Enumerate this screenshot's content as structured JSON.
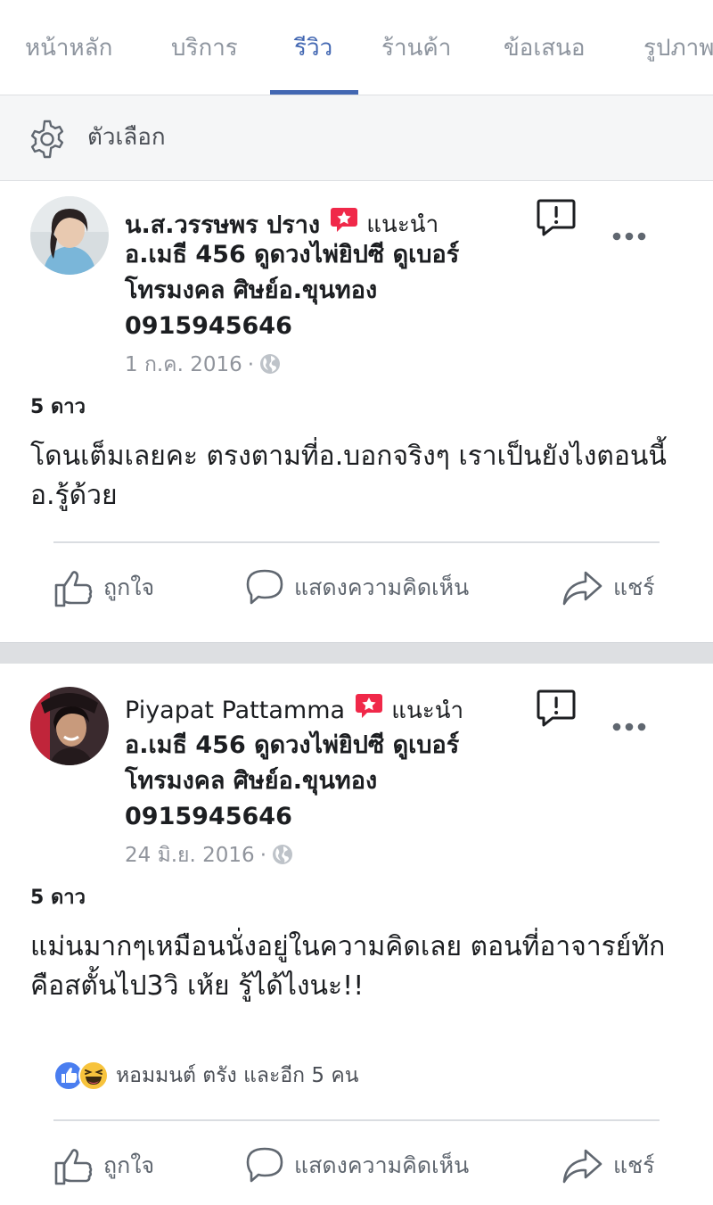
{
  "tabs": [
    {
      "label": "หน้าหลัก",
      "active": false
    },
    {
      "label": "บริการ",
      "active": false
    },
    {
      "label": "รีวิว",
      "active": true
    },
    {
      "label": "ร้านค้า",
      "active": false
    },
    {
      "label": "ข้อเสนอ",
      "active": false
    },
    {
      "label": "รูปภาพ",
      "active": false
    }
  ],
  "options": {
    "label": "ตัวเลือก",
    "icon": "gear-icon"
  },
  "reviews": [
    {
      "author": "น.ส.วรรษพร ปราง",
      "recommend_label": "แนะนำ",
      "page_line1": "อ.เมธี 456 ดูดวงไพ่ยิปซี ดูเบอร์",
      "page_line2": "โทรมงคล ศิษย์อ.ขุนทอง",
      "page_line3": "0915945646",
      "date": "1 ก.ค. 2016",
      "dot": "·",
      "rating": "5 ดาว",
      "text": "โดนเต็มเลยคะ  ตรงตามที่อ.บอกจริงๆ เราเป็นยังไงตอนนี้อ.รู้ด้วย",
      "reactions_text": ""
    },
    {
      "author": "Piyapat Pattamma",
      "recommend_label": "แนะนำ",
      "page_line1": "อ.เมธี 456 ดูดวงไพ่ยิปซี ดูเบอร์",
      "page_line2": "โทรมงคล ศิษย์อ.ขุนทอง",
      "page_line3": "0915945646",
      "date": "24 มิ.ย. 2016",
      "dot": "·",
      "rating": "5 ดาว",
      "text": "แม่นมากๆเหมือนนั่งอยู่ในความคิดเลย ตอนที่อาจารย์ทักคือสตั้นไป3วิ เห้ย รู้ได้ไงนะ!!",
      "reactions_text": "หอมมนต์ ตรัง และอีก 5 คน"
    }
  ],
  "actions": {
    "like": "ถูกใจ",
    "comment": "แสดงความคิดเห็น",
    "share": "แชร์"
  },
  "colors": {
    "accent": "#4267b2",
    "badge": "#f02849",
    "muted": "#90949c",
    "background": "#dddfe2"
  }
}
